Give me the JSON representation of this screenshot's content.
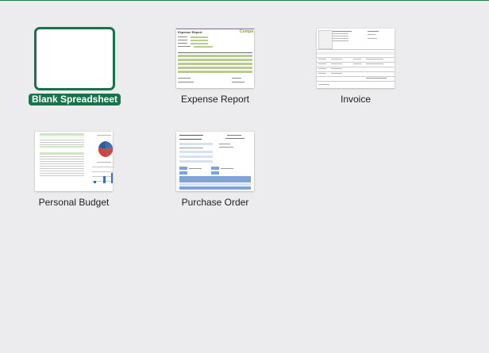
{
  "templates": [
    {
      "label": "Blank Spreadsheet",
      "selected": true
    },
    {
      "label": "Expense Report",
      "selected": false,
      "thumb_title": "Expense Report",
      "thumb_company": "Compa"
    },
    {
      "label": "Invoice",
      "selected": false
    },
    {
      "label": "Personal Budget",
      "selected": false
    },
    {
      "label": "Purchase Order",
      "selected": false
    }
  ],
  "colors": {
    "accent": "#17744a",
    "background": "#ecebee"
  }
}
